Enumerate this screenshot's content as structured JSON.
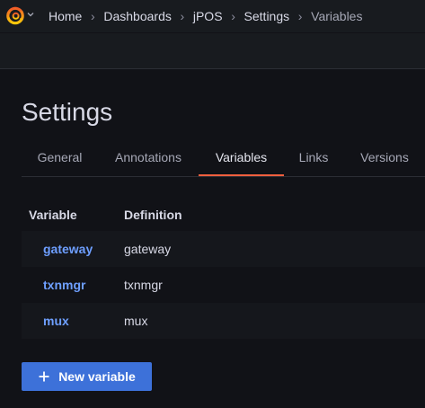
{
  "breadcrumb": {
    "items": [
      {
        "label": "Home"
      },
      {
        "label": "Dashboards"
      },
      {
        "label": "jPOS"
      },
      {
        "label": "Settings"
      },
      {
        "label": "Variables"
      }
    ],
    "separator": "›"
  },
  "page": {
    "title": "Settings"
  },
  "tabs": [
    {
      "label": "General",
      "active": false
    },
    {
      "label": "Annotations",
      "active": false
    },
    {
      "label": "Variables",
      "active": true
    },
    {
      "label": "Links",
      "active": false
    },
    {
      "label": "Versions",
      "active": false
    }
  ],
  "variables_table": {
    "columns": [
      "Variable",
      "Definition"
    ],
    "rows": [
      {
        "variable": "gateway",
        "definition": "gateway"
      },
      {
        "variable": "txnmgr",
        "definition": "txnmgr"
      },
      {
        "variable": "mux",
        "definition": "mux"
      }
    ]
  },
  "actions": {
    "new_variable_label": "New variable"
  },
  "colors": {
    "accent_tab": "#f55f3e",
    "link": "#6e9fff",
    "primary_button": "#3d71d9",
    "background": "#111217"
  },
  "icons": {
    "logo": "grafana-logo-icon",
    "chevron": "chevron-down-icon",
    "plus": "plus-icon"
  }
}
